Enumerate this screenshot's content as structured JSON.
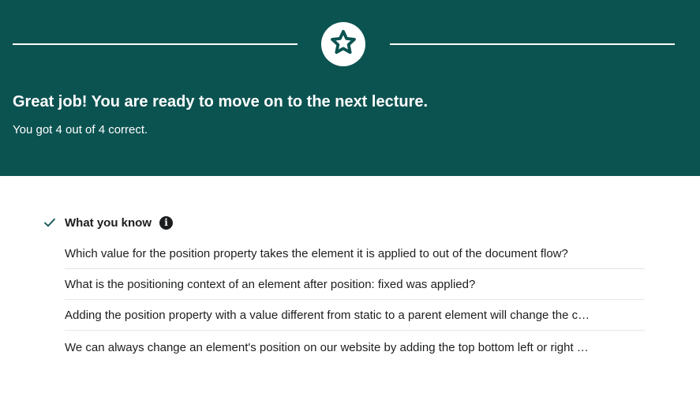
{
  "banner": {
    "background_color": "#0b5351",
    "badge_icon": "star-icon",
    "headline": "Great job! You are ready to move on to the next lecture.",
    "subline": "You got 4 out of 4 correct."
  },
  "knowledge": {
    "check_icon": "check-icon",
    "title": "What you know",
    "info_icon": "info-icon",
    "info_glyph": "i",
    "accent_color": "#0b5351",
    "questions": [
      "Which value for the position  property takes the element it is applied to out of the document flow?",
      "What is the positioning context of an element after position: fixed  was applied?",
      "Adding the position  property with a value different from static  to a parent element will change the c…",
      "We can always change an element's position on our website by adding the top  bottom  left  or right …"
    ]
  }
}
